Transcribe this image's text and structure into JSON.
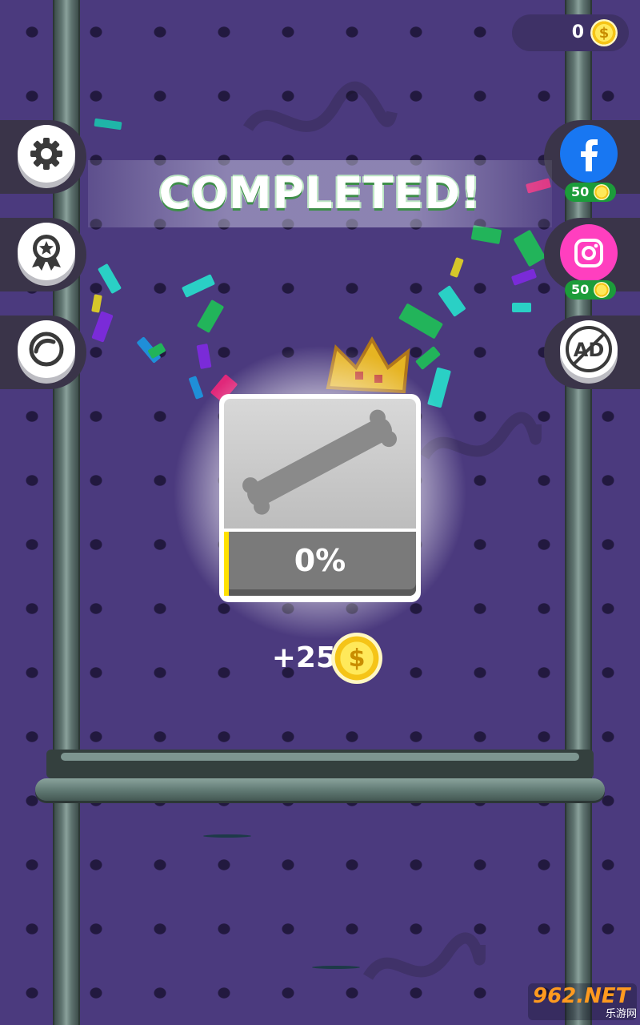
{
  "header": {
    "coins": "0",
    "coin_symbol": "$"
  },
  "banner": {
    "title": "COMPLETED!"
  },
  "left_menu": [
    {
      "id": "settings",
      "icon": "gear-icon"
    },
    {
      "id": "achievements",
      "icon": "award-badge-icon"
    },
    {
      "id": "skins",
      "icon": "ball-icon"
    }
  ],
  "right_menu": {
    "facebook": {
      "icon": "facebook-icon",
      "reward": "50"
    },
    "instagram": {
      "icon": "instagram-icon",
      "reward": "50"
    },
    "no_ads": {
      "label": "AD",
      "icon": "no-ads-icon"
    }
  },
  "result_card": {
    "item": "stick-icon",
    "progress_text": "0%",
    "progress_fraction": 0.02
  },
  "reward": {
    "amount": "+25",
    "coin_symbol": "$"
  },
  "watermark": {
    "brand": "962.NET",
    "sub": "乐游网"
  },
  "colors": {
    "background": "#4b3a7e",
    "facebook": "#1877f2",
    "instagram": "#ff3fbf",
    "progress": "#ffe100",
    "reward_pill": "#1c9c3a"
  }
}
